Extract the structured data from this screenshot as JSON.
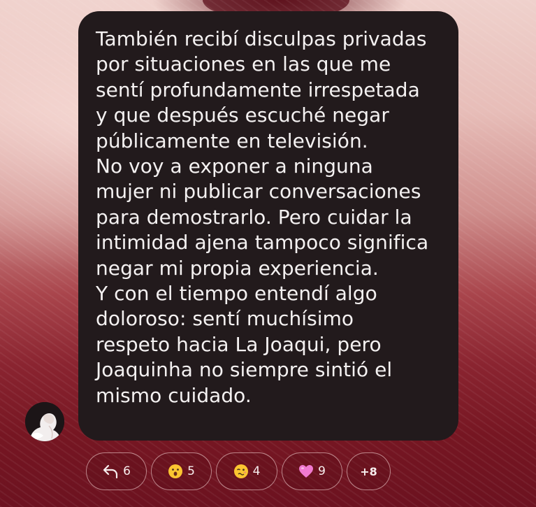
{
  "message": {
    "lines": [
      "También recibí disculpas privadas",
      "por situaciones en las que me",
      "sentí profundamente irrespetada",
      "y que después escuché negar",
      "públicamente en televisión.",
      "No voy a exponer a ninguna",
      "mujer ni publicar conversaciones",
      "para demostrarlo. Pero cuidar la",
      "intimidad ajena tampoco significa",
      "negar mi propia experiencia.",
      "Y con el tiempo entendí algo",
      "doloroso: sentí muchísimo",
      "respeto hacia La Joaqui, pero",
      "Joaquinha no siempre sintió el",
      "mismo cuidado."
    ]
  },
  "reactions": {
    "reply": {
      "icon": "reply-arrow-icon",
      "count": "6"
    },
    "items": [
      {
        "icon": "surprised-face-emoji",
        "count": "5"
      },
      {
        "icon": "woozy-face-emoji",
        "count": "4"
      },
      {
        "icon": "pink-heart-emoji",
        "count": "9"
      }
    ],
    "more": "+8"
  },
  "colors": {
    "bubble": "#221a1c",
    "text": "#f4f1f1",
    "pill_border": "#f0c8c8",
    "heart": "#f07ad0",
    "emoji_face": "#fbc531"
  }
}
